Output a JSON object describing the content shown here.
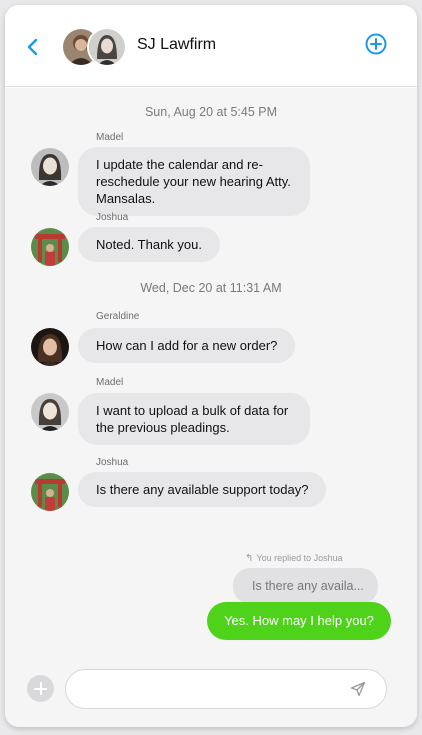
{
  "header": {
    "title": "SJ Lawfirm",
    "back_icon": "chevron-left-icon",
    "add_icon": "plus-circle-icon",
    "accent": "#1a9ae6"
  },
  "messages": [
    {
      "type": "timestamp",
      "text": "Sun, Aug 20 at 5:45 PM"
    },
    {
      "sender": "Madel",
      "text": "I update the calendar and re-reschedule your new hearing Atty. Mansalas."
    },
    {
      "sender": "Joshua",
      "text": "Noted. Thank you."
    },
    {
      "type": "timestamp",
      "text": "Wed, Dec 20 at 11:31 AM"
    },
    {
      "sender": "Geraldine",
      "text": "How can I add for a new order?"
    },
    {
      "sender": "Madel",
      "text": "I want to upload a bulk of data for the previous pleadings."
    },
    {
      "sender": "Joshua",
      "text": "Is there any available support today?"
    }
  ],
  "reply": {
    "note": "You replied to Joshua",
    "quoted": "Is there any availa...",
    "sent": "Yes. How may I help you?",
    "sent_color": "#4ed21a"
  },
  "composer": {
    "placeholder": "",
    "value": "",
    "send_icon": "send-icon",
    "add_icon": "plus-icon"
  }
}
